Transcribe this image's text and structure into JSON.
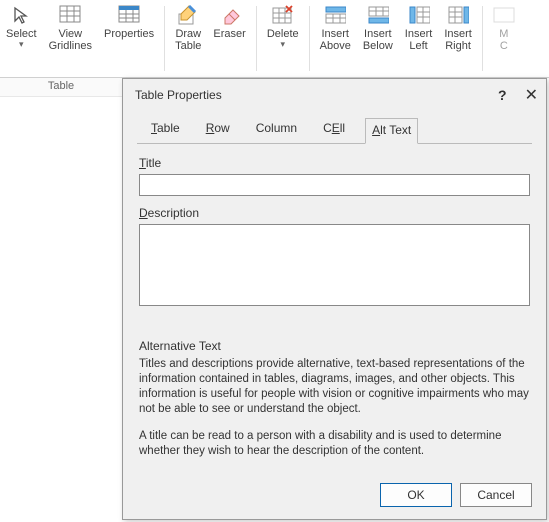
{
  "ribbon": {
    "select": "Select",
    "view_gridlines_l1": "View",
    "view_gridlines_l2": "Gridlines",
    "properties": "Properties",
    "draw_table_l1": "Draw",
    "draw_table_l2": "Table",
    "eraser": "Eraser",
    "delete": "Delete",
    "insert_above_l1": "Insert",
    "insert_above_l2": "Above",
    "insert_below_l1": "Insert",
    "insert_below_l2": "Below",
    "insert_left_l1": "Insert",
    "insert_left_l2": "Left",
    "insert_right_l1": "Insert",
    "insert_right_l2": "Right",
    "merge_cut": "M",
    "merge_cut2": "C",
    "group_table": "Table"
  },
  "dialog": {
    "title": "Table Properties",
    "help": "?",
    "close": "✕",
    "tabs": {
      "table_u": "T",
      "table_r": "able",
      "row_u": "R",
      "row_r": "ow",
      "column": "Column",
      "cell_u": "E",
      "cell_pre": "C",
      "cell_r": "ll",
      "alt_u": "A",
      "alt_r": "lt Text"
    },
    "title_label_u": "T",
    "title_label_r": "itle",
    "title_value": "",
    "desc_label_u": "D",
    "desc_label_r": "escription",
    "desc_value": "",
    "alt_heading": "Alternative Text",
    "help1": "Titles and descriptions provide alternative, text-based representations of the information contained in tables, diagrams, images, and other objects. This information is useful for people with vision or cognitive impairments who may not be able to see or understand the object.",
    "help2": "A title can be read to a person with a disability and is used to determine whether they wish to hear the description of the content.",
    "ok": "OK",
    "cancel": "Cancel"
  }
}
